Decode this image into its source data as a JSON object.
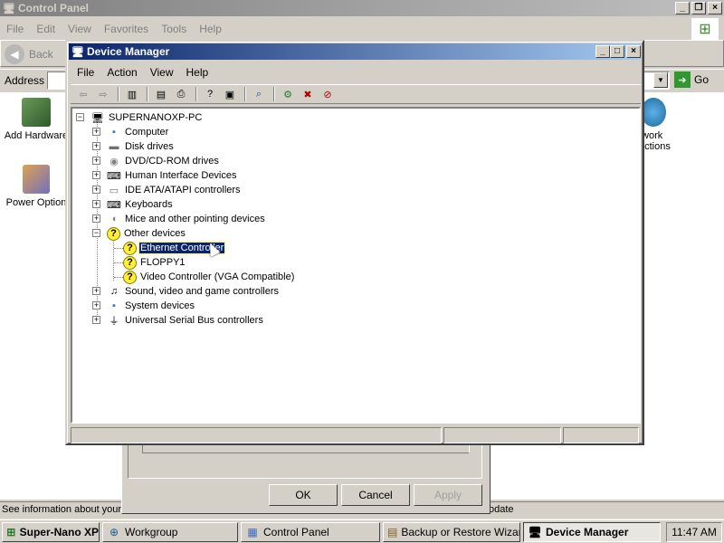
{
  "control_panel": {
    "title": "Control Panel",
    "menu": [
      "File",
      "Edit",
      "View",
      "Favorites",
      "Tools",
      "Help"
    ],
    "back_label": "Back",
    "address_label": "Address",
    "go_label": "Go",
    "icons": [
      {
        "label": "Add Hardware",
        "icon": "add-hardware-icon"
      },
      {
        "label": "Power Option",
        "icon": "power-options-icon"
      },
      {
        "label": "twork",
        "icon": "network-icon"
      },
      {
        "label": "ections",
        "icon": "network-icon"
      }
    ],
    "status_text": "See information about your",
    "status_tail": "odate"
  },
  "wizard": {
    "ok_label": "OK",
    "cancel_label": "Cancel",
    "apply_label": "Apply"
  },
  "device_manager": {
    "title": "Device Manager",
    "menu": [
      "File",
      "Action",
      "View",
      "Help"
    ],
    "root": "SUPERNANOXP-PC",
    "categories": [
      {
        "label": "Computer",
        "icon": "computer-icon"
      },
      {
        "label": "Disk drives",
        "icon": "disk-icon"
      },
      {
        "label": "DVD/CD-ROM drives",
        "icon": "cdrom-icon"
      },
      {
        "label": "Human Interface Devices",
        "icon": "hid-icon"
      },
      {
        "label": "IDE ATA/ATAPI controllers",
        "icon": "ide-icon"
      },
      {
        "label": "Keyboards",
        "icon": "keyboard-icon"
      },
      {
        "label": "Mice and other pointing devices",
        "icon": "mouse-icon"
      },
      {
        "label": "Other devices",
        "icon": "unknown-device-icon"
      },
      {
        "label": "Ethernet Controller",
        "icon": "unknown-device-icon"
      },
      {
        "label": "FLOPPY1",
        "icon": "unknown-device-icon"
      },
      {
        "label": "Video Controller (VGA Compatible)",
        "icon": "unknown-device-icon"
      },
      {
        "label": "Sound, video and game controllers",
        "icon": "sound-icon"
      },
      {
        "label": "System devices",
        "icon": "system-icon"
      },
      {
        "label": "Universal Serial Bus controllers",
        "icon": "usb-icon"
      }
    ]
  },
  "taskbar": {
    "items": [
      {
        "label": "Super-Nano XP",
        "icon": "windows-icon"
      },
      {
        "label": "Workgroup",
        "icon": "network-icon"
      },
      {
        "label": "Control Panel",
        "icon": "control-panel-icon"
      },
      {
        "label": "Backup or Restore Wizard",
        "icon": "backup-icon"
      },
      {
        "label": "Device Manager",
        "icon": "device-manager-icon"
      }
    ],
    "clock": "11:47 AM"
  }
}
